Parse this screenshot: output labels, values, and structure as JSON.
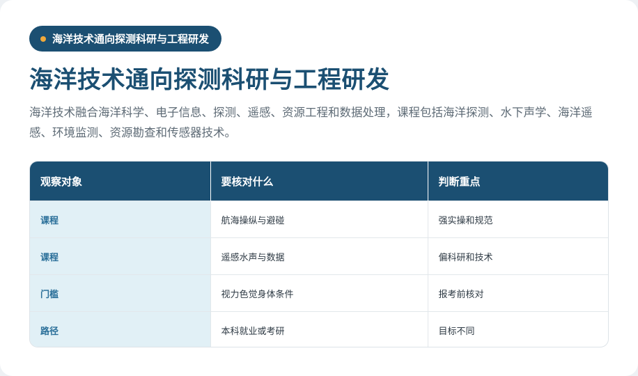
{
  "badge": {
    "label": "海洋技术通向探测科研与工程研发",
    "dot_color": "#f0a93b"
  },
  "title": "海洋技术通向探测科研与工程研发",
  "description": "海洋技术融合海洋科学、电子信息、探测、遥感、资源工程和数据处理，课程包括海洋探测、水下声学、海洋遥感、环境监测、资源勘查和传感器技术。",
  "colors": {
    "primary": "#1b4f72",
    "accent": "#f0a93b",
    "first_column_bg": "#e1f0f6"
  },
  "table": {
    "headers": [
      "观察对象",
      "要核对什么",
      "判断重点"
    ],
    "rows": [
      [
        "课程",
        "航海操纵与避碰",
        "强实操和规范"
      ],
      [
        "课程",
        "遥感水声与数据",
        "偏科研和技术"
      ],
      [
        "门槛",
        "视力色觉身体条件",
        "报考前核对"
      ],
      [
        "路径",
        "本科就业或考研",
        "目标不同"
      ]
    ]
  }
}
